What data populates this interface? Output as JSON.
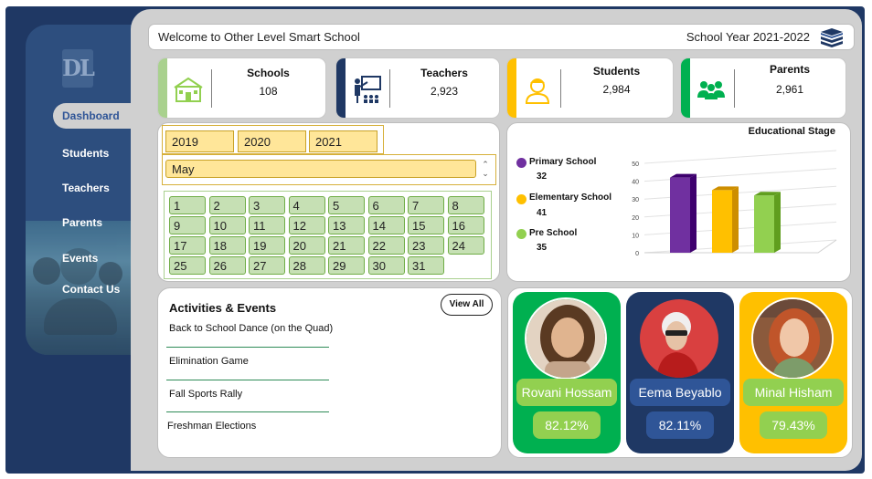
{
  "sidebar": {
    "logo_text": "DL",
    "items": [
      {
        "label": "Dashboard",
        "active": true
      },
      {
        "label": "Students"
      },
      {
        "label": "Teachers"
      },
      {
        "label": "Parents"
      },
      {
        "label": "Events"
      },
      {
        "label": "Contact Us"
      }
    ]
  },
  "header": {
    "welcome": "Welcome to Other Level Smart School",
    "school_year": "School Year 2021-2022",
    "icon": "books-icon"
  },
  "kpis": [
    {
      "label": "Schools",
      "value": "108",
      "color": "#a9d18e",
      "icon": "school-icon"
    },
    {
      "label": "Teachers",
      "value": "2,923",
      "color": "#1f3864",
      "icon": "teacher-icon"
    },
    {
      "label": "Students",
      "value": "2,984",
      "color": "#ffc000",
      "icon": "student-icon"
    },
    {
      "label": "Parents",
      "value": "2,961",
      "color": "#00b050",
      "icon": "parents-icon"
    }
  ],
  "calendar": {
    "years": [
      "2019",
      "2020",
      "2021"
    ],
    "month": "May",
    "days": [
      "1",
      "2",
      "3",
      "4",
      "5",
      "6",
      "7",
      "8",
      "9",
      "10",
      "11",
      "12",
      "13",
      "14",
      "15",
      "16",
      "17",
      "18",
      "19",
      "20",
      "21",
      "22",
      "23",
      "24",
      "25",
      "26",
      "27",
      "28",
      "29",
      "30",
      "31"
    ]
  },
  "chart_data": {
    "type": "bar",
    "title": "Educational Stage",
    "categories": [
      "Primary School",
      "Elementary School",
      "Pre School"
    ],
    "values": [
      32,
      41,
      35
    ],
    "colors": [
      "#7030a0",
      "#ffc000",
      "#92d050"
    ],
    "ylim": [
      0,
      50
    ],
    "yticks": [
      "0",
      "10",
      "20",
      "30",
      "40",
      "50"
    ],
    "bar_heights": [
      42,
      35,
      32
    ],
    "legend_position": "left"
  },
  "legend": [
    {
      "name": "Primary School",
      "value": "32",
      "color": "#7030a0"
    },
    {
      "name": "Elementary School",
      "value": "41",
      "color": "#ffc000"
    },
    {
      "name": "Pre School",
      "value": "35",
      "color": "#92d050"
    }
  ],
  "activities": {
    "title": "Activities & Events",
    "view_all": "View All",
    "items": [
      "Back to School Dance (on the Quad)",
      "Elimination Game",
      "Fall Sports Rally",
      "Freshman Elections"
    ]
  },
  "people": [
    {
      "name": "Rovani Hossam",
      "pct": "82.12%",
      "card": "#00b050",
      "name_bg": "#92d050",
      "pct_bg": "#92d050",
      "text": "#ffffff"
    },
    {
      "name": "Eema Beyablo",
      "pct": "82.11%",
      "card": "#1f3864",
      "name_bg": "#2f5597",
      "pct_bg": "#2f5597",
      "text": "#ffffff"
    },
    {
      "name": "Minal Hisham",
      "pct": "79.43%",
      "card": "#ffc000",
      "name_bg": "#92d050",
      "pct_bg": "#92d050",
      "text": "#ffffff"
    }
  ]
}
